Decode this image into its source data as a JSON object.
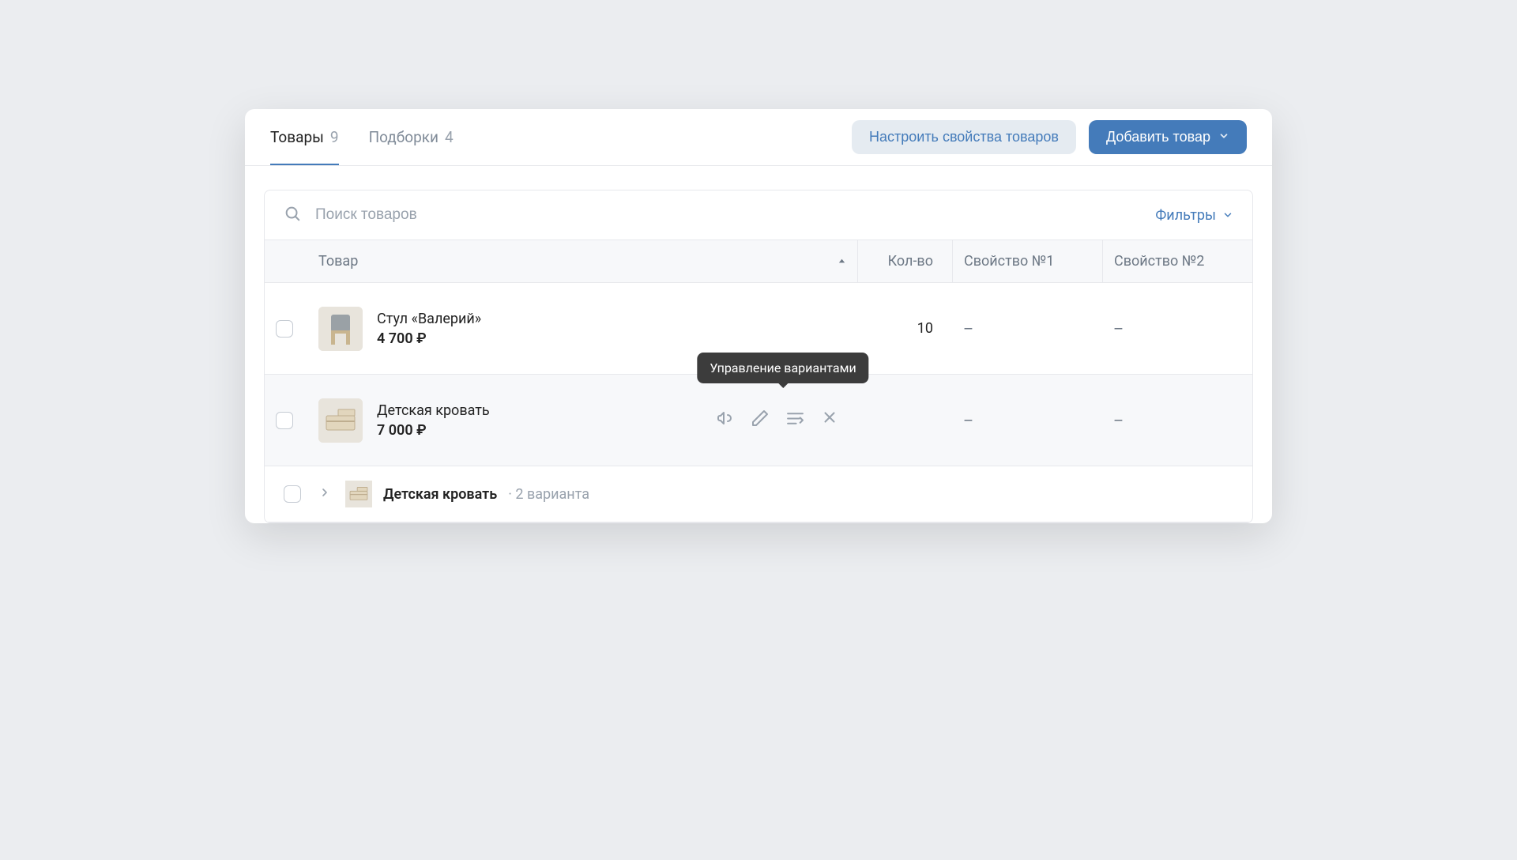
{
  "tabs": {
    "products": {
      "label": "Товары",
      "count": "9"
    },
    "collections": {
      "label": "Подборки",
      "count": "4"
    }
  },
  "actions": {
    "setup_props": "Настроить свойства товаров",
    "add_product": "Добавить товар"
  },
  "search": {
    "placeholder": "Поиск товаров"
  },
  "filters_label": "Фильтры",
  "columns": {
    "product": "Товар",
    "qty": "Кол-во",
    "prop1": "Свойство №1",
    "prop2": "Свойство №2"
  },
  "rows": [
    {
      "name": "Стул «Валерий»",
      "price": "4 700 ₽",
      "qty": "10",
      "prop1": "–",
      "prop2": "–"
    },
    {
      "name": "Детская кровать",
      "price": "7 000 ₽",
      "qty": "",
      "prop1": "–",
      "prop2": "–"
    }
  ],
  "tooltip": "Управление вариантами",
  "variant_group": {
    "name": "Детская кровать",
    "count": "2 варианта"
  }
}
